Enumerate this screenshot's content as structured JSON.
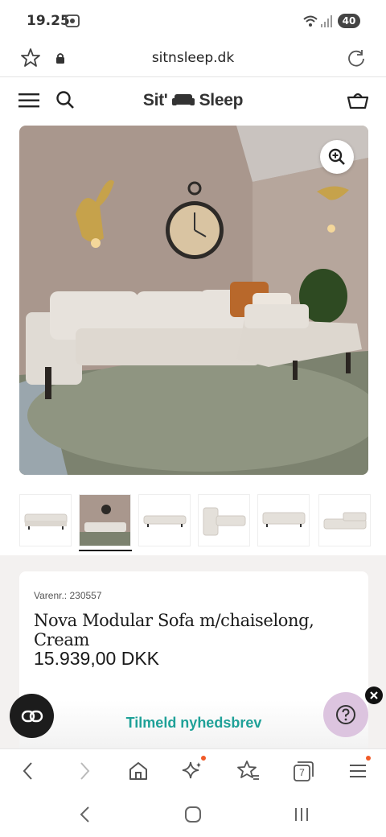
{
  "status": {
    "time": "19.25",
    "battery": "40"
  },
  "browser": {
    "url": "sitnsleep.dk",
    "tab_count": "7"
  },
  "site": {
    "logo_left": "Sit'",
    "logo_right": "Sleep"
  },
  "product": {
    "sku": "Varenr.: 230557",
    "title": "Nova Modular Sofa m/chaiselong, Cream",
    "price": "15.939,00 DKK",
    "thumbnail_count": 6,
    "selected_thumbnail": 2
  },
  "newsletter": {
    "label": "Tilmeld nyhedsbrev"
  },
  "colors": {
    "accent": "#1fa198",
    "help_bg": "#dcc4df",
    "notify_dot": "#f05a28"
  },
  "icons": {
    "top": [
      "wifi-icon",
      "signal-icon",
      "bookmark-star-icon",
      "lock-icon",
      "reload-icon"
    ],
    "header": [
      "menu-icon",
      "search-icon",
      "basket-icon"
    ],
    "toolbar": [
      "back-icon",
      "forward-icon",
      "home-icon",
      "sparkle-icon",
      "bookmarks-icon",
      "tabs-icon",
      "more-menu-icon"
    ]
  }
}
